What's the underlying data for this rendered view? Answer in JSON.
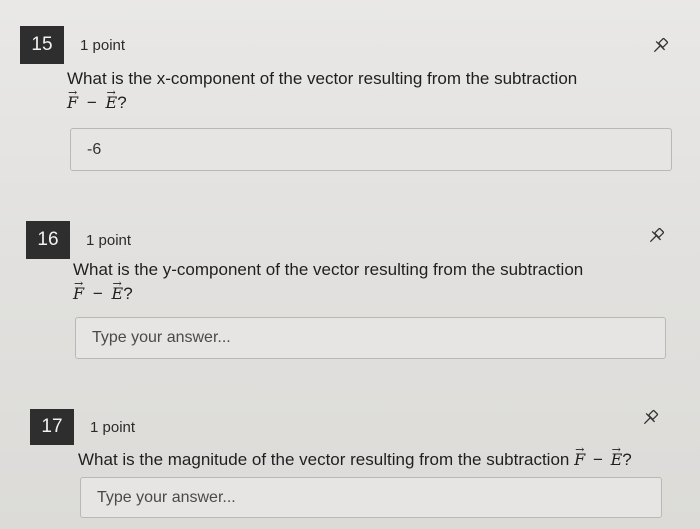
{
  "questions": [
    {
      "number": "15",
      "points": "1 point",
      "prompt_line1": "What is the x-component of the vector resulting from the subtraction",
      "vec_a": "F",
      "minus": "−",
      "vec_b": "E",
      "suffix": "?",
      "answer_value": "-6",
      "pin_icon": "pin-icon"
    },
    {
      "number": "16",
      "points": "1 point",
      "prompt_line1": "What is the y-component of the vector resulting from the subtraction",
      "vec_a": "F",
      "minus": "−",
      "vec_b": "E",
      "suffix": "?",
      "answer_placeholder": "Type your answer...",
      "pin_icon": "pin-icon"
    },
    {
      "number": "17",
      "points": "1 point",
      "prompt_line1": "What is the magnitude of the vector resulting from the subtraction",
      "vec_a": "F",
      "minus": "−",
      "vec_b": "E",
      "suffix": "?",
      "answer_placeholder": "Type your answer...",
      "pin_icon": "pin-icon"
    }
  ],
  "arrow_glyph": "→"
}
